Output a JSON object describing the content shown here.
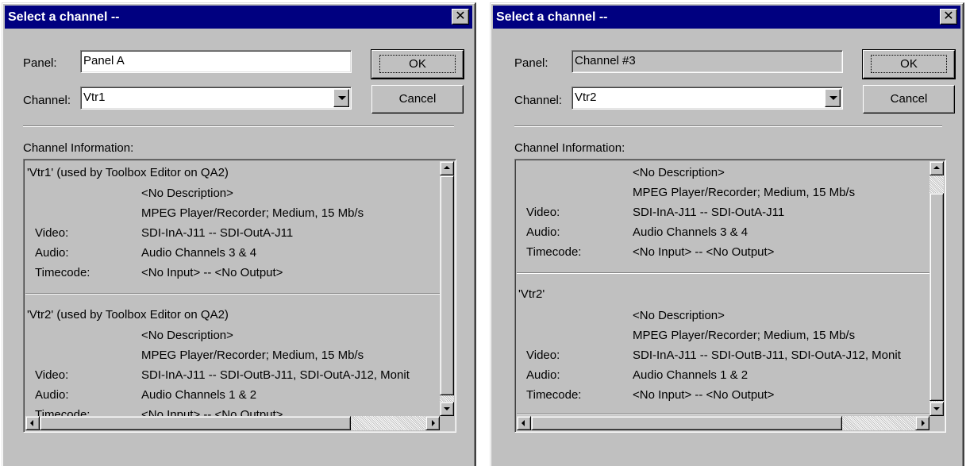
{
  "dialogs": [
    {
      "title": "Select a channel --",
      "close_glyph": "✕",
      "panel_label": "Panel:",
      "panel_value": "Panel A",
      "channel_label": "Channel:",
      "channel_value": "Vtr1",
      "ok_label": "OK",
      "cancel_label": "Cancel",
      "info_label": "Channel Information:",
      "entries": [
        {
          "header": "'Vtr1' (used by Toolbox Editor on QA2)",
          "rows": [
            {
              "key": "",
              "value": "<No Description>"
            },
            {
              "key": "",
              "value": "MPEG Player/Recorder; Medium, 15 Mb/s"
            },
            {
              "key": "Video:",
              "value": "SDI-InA-J11 -- SDI-OutA-J11"
            },
            {
              "key": "Audio:",
              "value": "Audio Channels 3 & 4"
            },
            {
              "key": "Timecode:",
              "value": "<No Input> -- <No Output>"
            }
          ]
        },
        {
          "header": "'Vtr2' (used by Toolbox Editor on QA2)",
          "rows": [
            {
              "key": "",
              "value": "<No Description>"
            },
            {
              "key": "",
              "value": "MPEG Player/Recorder; Medium, 15 Mb/s"
            },
            {
              "key": "Video:",
              "value": "SDI-InA-J11 -- SDI-OutB-J11, SDI-OutA-J12, Monit"
            },
            {
              "key": "Audio:",
              "value": "Audio Channels 1 & 2"
            },
            {
              "key": "Timecode:",
              "value": "<No Input> -- <No Output>"
            }
          ]
        }
      ]
    },
    {
      "title": "Select a channel --",
      "close_glyph": "✕",
      "panel_label": "Panel:",
      "panel_value": "Channel #3",
      "channel_label": "Channel:",
      "channel_value": "Vtr2",
      "ok_label": "OK",
      "cancel_label": "Cancel",
      "info_label": "Channel Information:",
      "entries": [
        {
          "header": "",
          "rows": [
            {
              "key": "",
              "value": "<No Description>"
            },
            {
              "key": "",
              "value": "MPEG Player/Recorder; Medium, 15 Mb/s"
            },
            {
              "key": "Video:",
              "value": "SDI-InA-J11 -- SDI-OutA-J11"
            },
            {
              "key": "Audio:",
              "value": "Audio Channels 3 & 4"
            },
            {
              "key": "Timecode:",
              "value": "<No Input> -- <No Output>"
            }
          ]
        },
        {
          "header": "'Vtr2'",
          "rows": [
            {
              "key": "",
              "value": "<No Description>"
            },
            {
              "key": "",
              "value": "MPEG Player/Recorder; Medium, 15 Mb/s"
            },
            {
              "key": "Video:",
              "value": "SDI-InA-J11 -- SDI-OutB-J11, SDI-OutA-J12, Monit"
            },
            {
              "key": "Audio:",
              "value": "Audio Channels 1 & 2"
            },
            {
              "key": "Timecode:",
              "value": "<No Input> -- <No Output>"
            }
          ]
        }
      ]
    }
  ]
}
